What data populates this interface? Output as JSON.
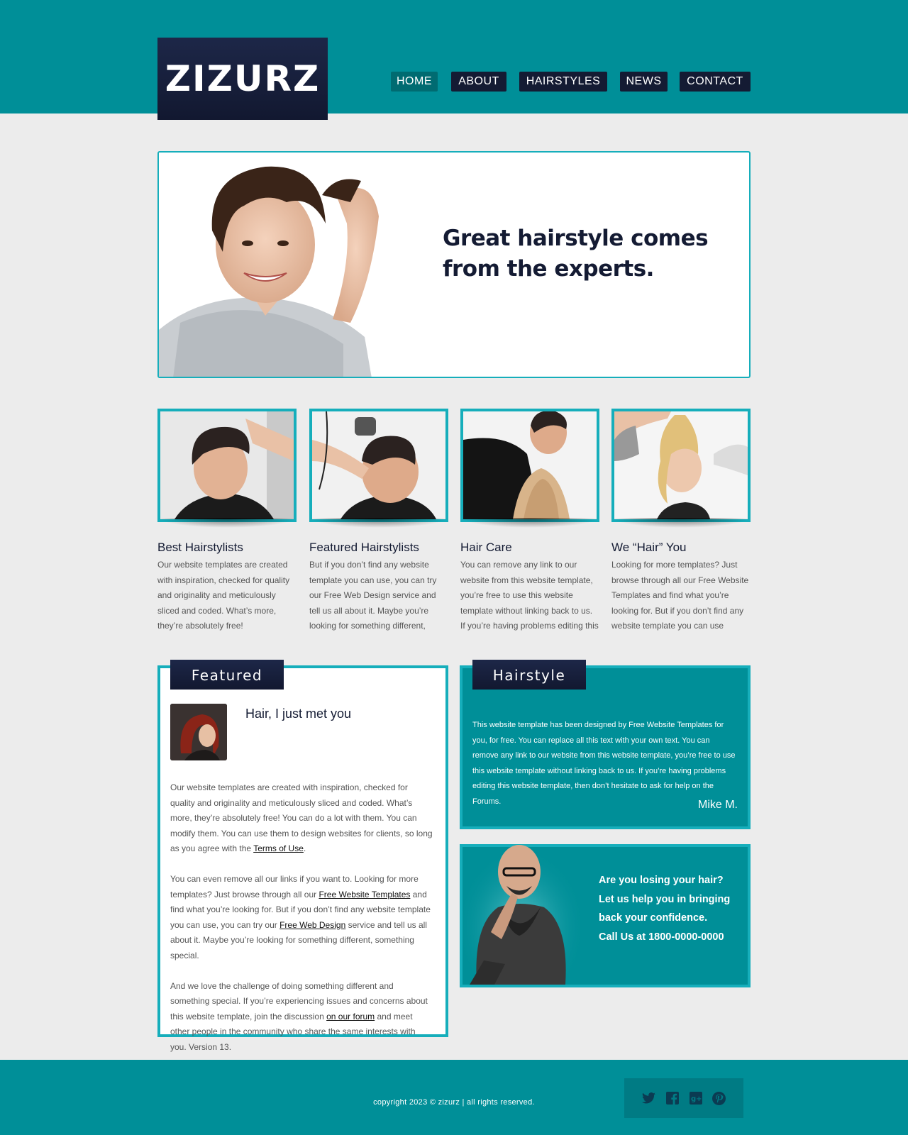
{
  "header": {
    "logo": "ZIZURZ",
    "nav": [
      {
        "label": "HOME"
      },
      {
        "label": "ABOUT"
      },
      {
        "label": "HAIRSTYLES"
      },
      {
        "label": "NEWS"
      },
      {
        "label": "CONTACT"
      }
    ]
  },
  "hero": {
    "headline_line1": "Great hairstyle comes",
    "headline_line2": "from the experts."
  },
  "columns": [
    {
      "title": "Best Hairstylists",
      "text": "Our website templates are created with inspiration, checked for quality and originality and meticulously sliced and coded. What’s more, they’re absolutely free!"
    },
    {
      "title": "Featured Hairstylists",
      "text": "But if you don’t find any website template you can use, you can try our Free Web Design service and tell us all about it. Maybe you’re looking for something different, something"
    },
    {
      "title": "Hair Care",
      "text": "You can remove any link to our website from this website template, you’re free to use this website template without linking back to us. If you’re having problems editing this"
    },
    {
      "title": "We “Hair” You",
      "text": "Looking for more templates? Just browse through all our Free Website Templates and find what you’re looking for. But if you don’t find any website template you can use"
    }
  ],
  "featured": {
    "tab": "Featured",
    "title": "Hair, I just met you",
    "p1_a": "Our website templates are created with inspiration, checked for quality and originality and meticulously sliced and coded. What’s more, they’re absolutely free! You can do a lot with them. You can modify them. You can use them to design websites for clients, so long as you agree with the ",
    "p1_link": "Terms of Use",
    "p1_b": ".",
    "p2_a": "You can even remove all our links if you want to. Looking for more templates? Just browse through all our ",
    "p2_link1": "Free Website Templates",
    "p2_b": " and find what you’re looking for. But if you don’t find any website template you can use, you can try our ",
    "p2_link2": "Free Web Design",
    "p2_c": " service and tell us all about it. Maybe you’re looking for something different, something special.",
    "p3_a": "And we love the challenge of doing something different and something special. If you’re experiencing issues and concerns about this website template, join the discussion ",
    "p3_link": "on our forum",
    "p3_b": " and meet other people in the community who share the same interests with you. Version 13."
  },
  "hairstyle": {
    "tab": "Hairstyle",
    "text": "This website template has been designed by Free Website Templates for you, for free. You can replace all this text with your own text. You can remove any link to our website from this website template, you’re free to use this website template without linking back to us. If you’re having problems editing this website template, then don’t hesitate to ask for help on the Forums.",
    "signature": "Mike M."
  },
  "promo": {
    "line1": "Are you losing your hair?",
    "line2": "Let us help you in bringing",
    "line3": "back your confidence.",
    "line4": "Call Us at 1800-0000-0000"
  },
  "footer": {
    "copyright": "copyright 2023 © zizurz | all rights reserved.",
    "social_icons": [
      "twitter-icon",
      "facebook-icon",
      "googleplus-icon",
      "pinterest-icon"
    ]
  },
  "colors": {
    "teal": "#008f98",
    "border_teal": "#16aebb",
    "navy": "#141b33",
    "background": "#ececec"
  }
}
